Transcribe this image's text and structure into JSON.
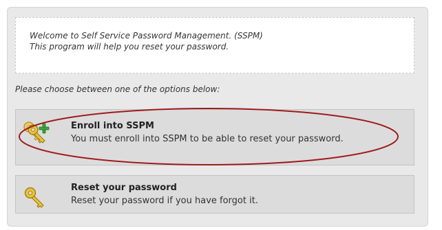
{
  "welcome": {
    "line1": "Welcome to Self Service Password Management. (SSPM)",
    "line2": "This program will help you reset your password."
  },
  "instruction": "Please choose between one of the options below:",
  "options": [
    {
      "title": "Enroll into SSPM",
      "description": "You must enroll into SSPM to be able to reset your password.",
      "icon": "key-add-icon"
    },
    {
      "title": "Reset your password",
      "description": "Reset your password if you have forgot it.",
      "icon": "key-icon"
    }
  ],
  "colors": {
    "panel_bg": "#e9e9e9",
    "option_bg": "#dcdcdc",
    "highlight_ellipse": "#9e1b1b",
    "key_gold": "#e0b62a",
    "plus_green": "#3aa83a"
  }
}
